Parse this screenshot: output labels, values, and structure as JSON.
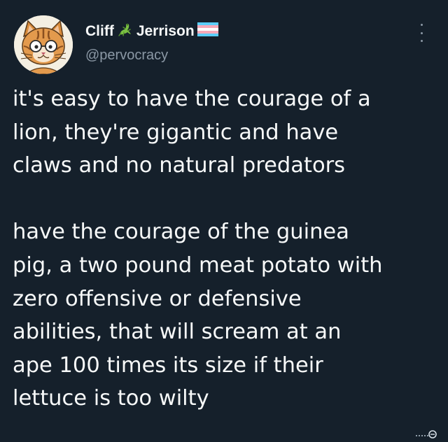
{
  "author": {
    "name_first": "Cliff",
    "name_last": "Jerrison",
    "handle": "@pervocracy",
    "lizard_emoji": "🦎",
    "flag_emoji": "transgender-flag"
  },
  "tweet": {
    "paragraph1": [
      "it's easy to have the courage of a",
      "lion, they're gigantic and have",
      "claws and no natural predators"
    ],
    "paragraph2": [
      "have the courage of the guinea",
      "pig, a two pound meat potato with",
      "zero offensive or defensive",
      "abilities, that will scream at an",
      "ape 100 times its size if their",
      "lettuce is too wilty"
    ]
  },
  "icons": {
    "more": "more-options-icon",
    "watermark": "watermark-icon"
  },
  "colors": {
    "background": "#15202b",
    "text": "#f7f9f9",
    "secondary": "#8b98a5",
    "flag_blue": "#5bcefa",
    "flag_pink": "#f5a9b8",
    "flag_white": "#ffffff"
  }
}
